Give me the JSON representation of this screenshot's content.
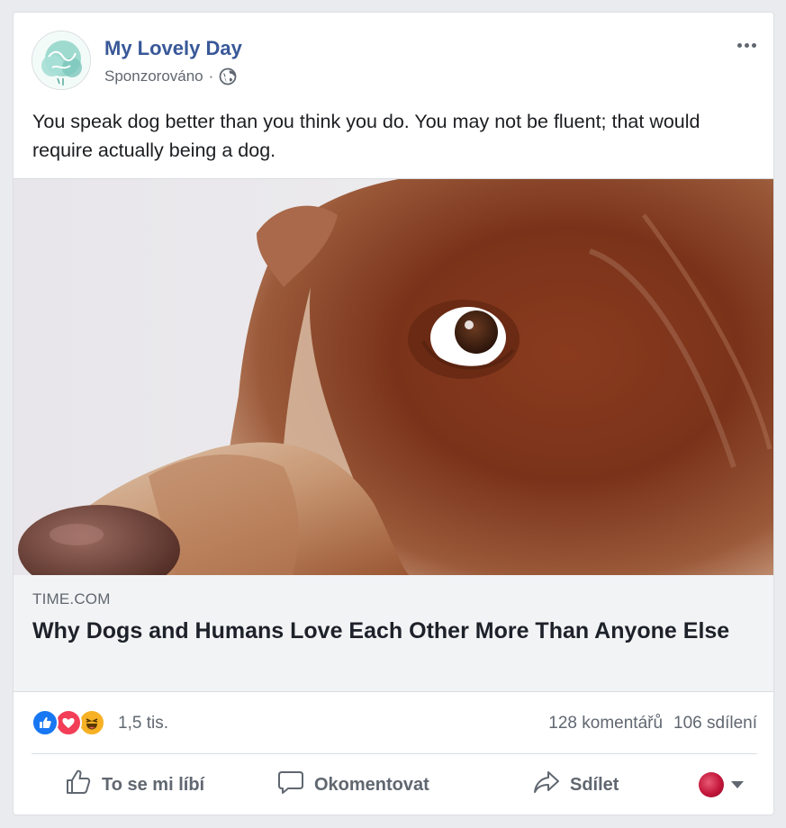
{
  "post": {
    "page_name": "My Lovely Day",
    "sponsored_label": "Sponzorováno",
    "separator": "·",
    "audience_icon": "globe-icon",
    "more_icon": "more-horizontal-icon",
    "text": "You speak dog better than you think you do. You may not be fluent; that would require actually being a dog."
  },
  "link_preview": {
    "image_subject": "brown-and-white dog looking sideways",
    "domain": "TIME.COM",
    "title": "Why Dogs and Humans Love Each Other More Than Anyone Else"
  },
  "stats": {
    "reaction_icons": [
      "like-reaction-icon",
      "love-reaction-icon",
      "haha-reaction-icon"
    ],
    "reaction_count": "1,5 tis.",
    "comments": "128 komentářů",
    "shares": "106 sdílení"
  },
  "actions": {
    "like": "To se mi líbí",
    "comment": "Okomentovat",
    "share": "Sdílet"
  },
  "colors": {
    "page_name": "#385898",
    "like_blue": "#1877f2",
    "love_red": "#f33e58",
    "haha_yellow": "#f7b125",
    "secondary_text": "#606770",
    "background": "#e9ebee"
  }
}
